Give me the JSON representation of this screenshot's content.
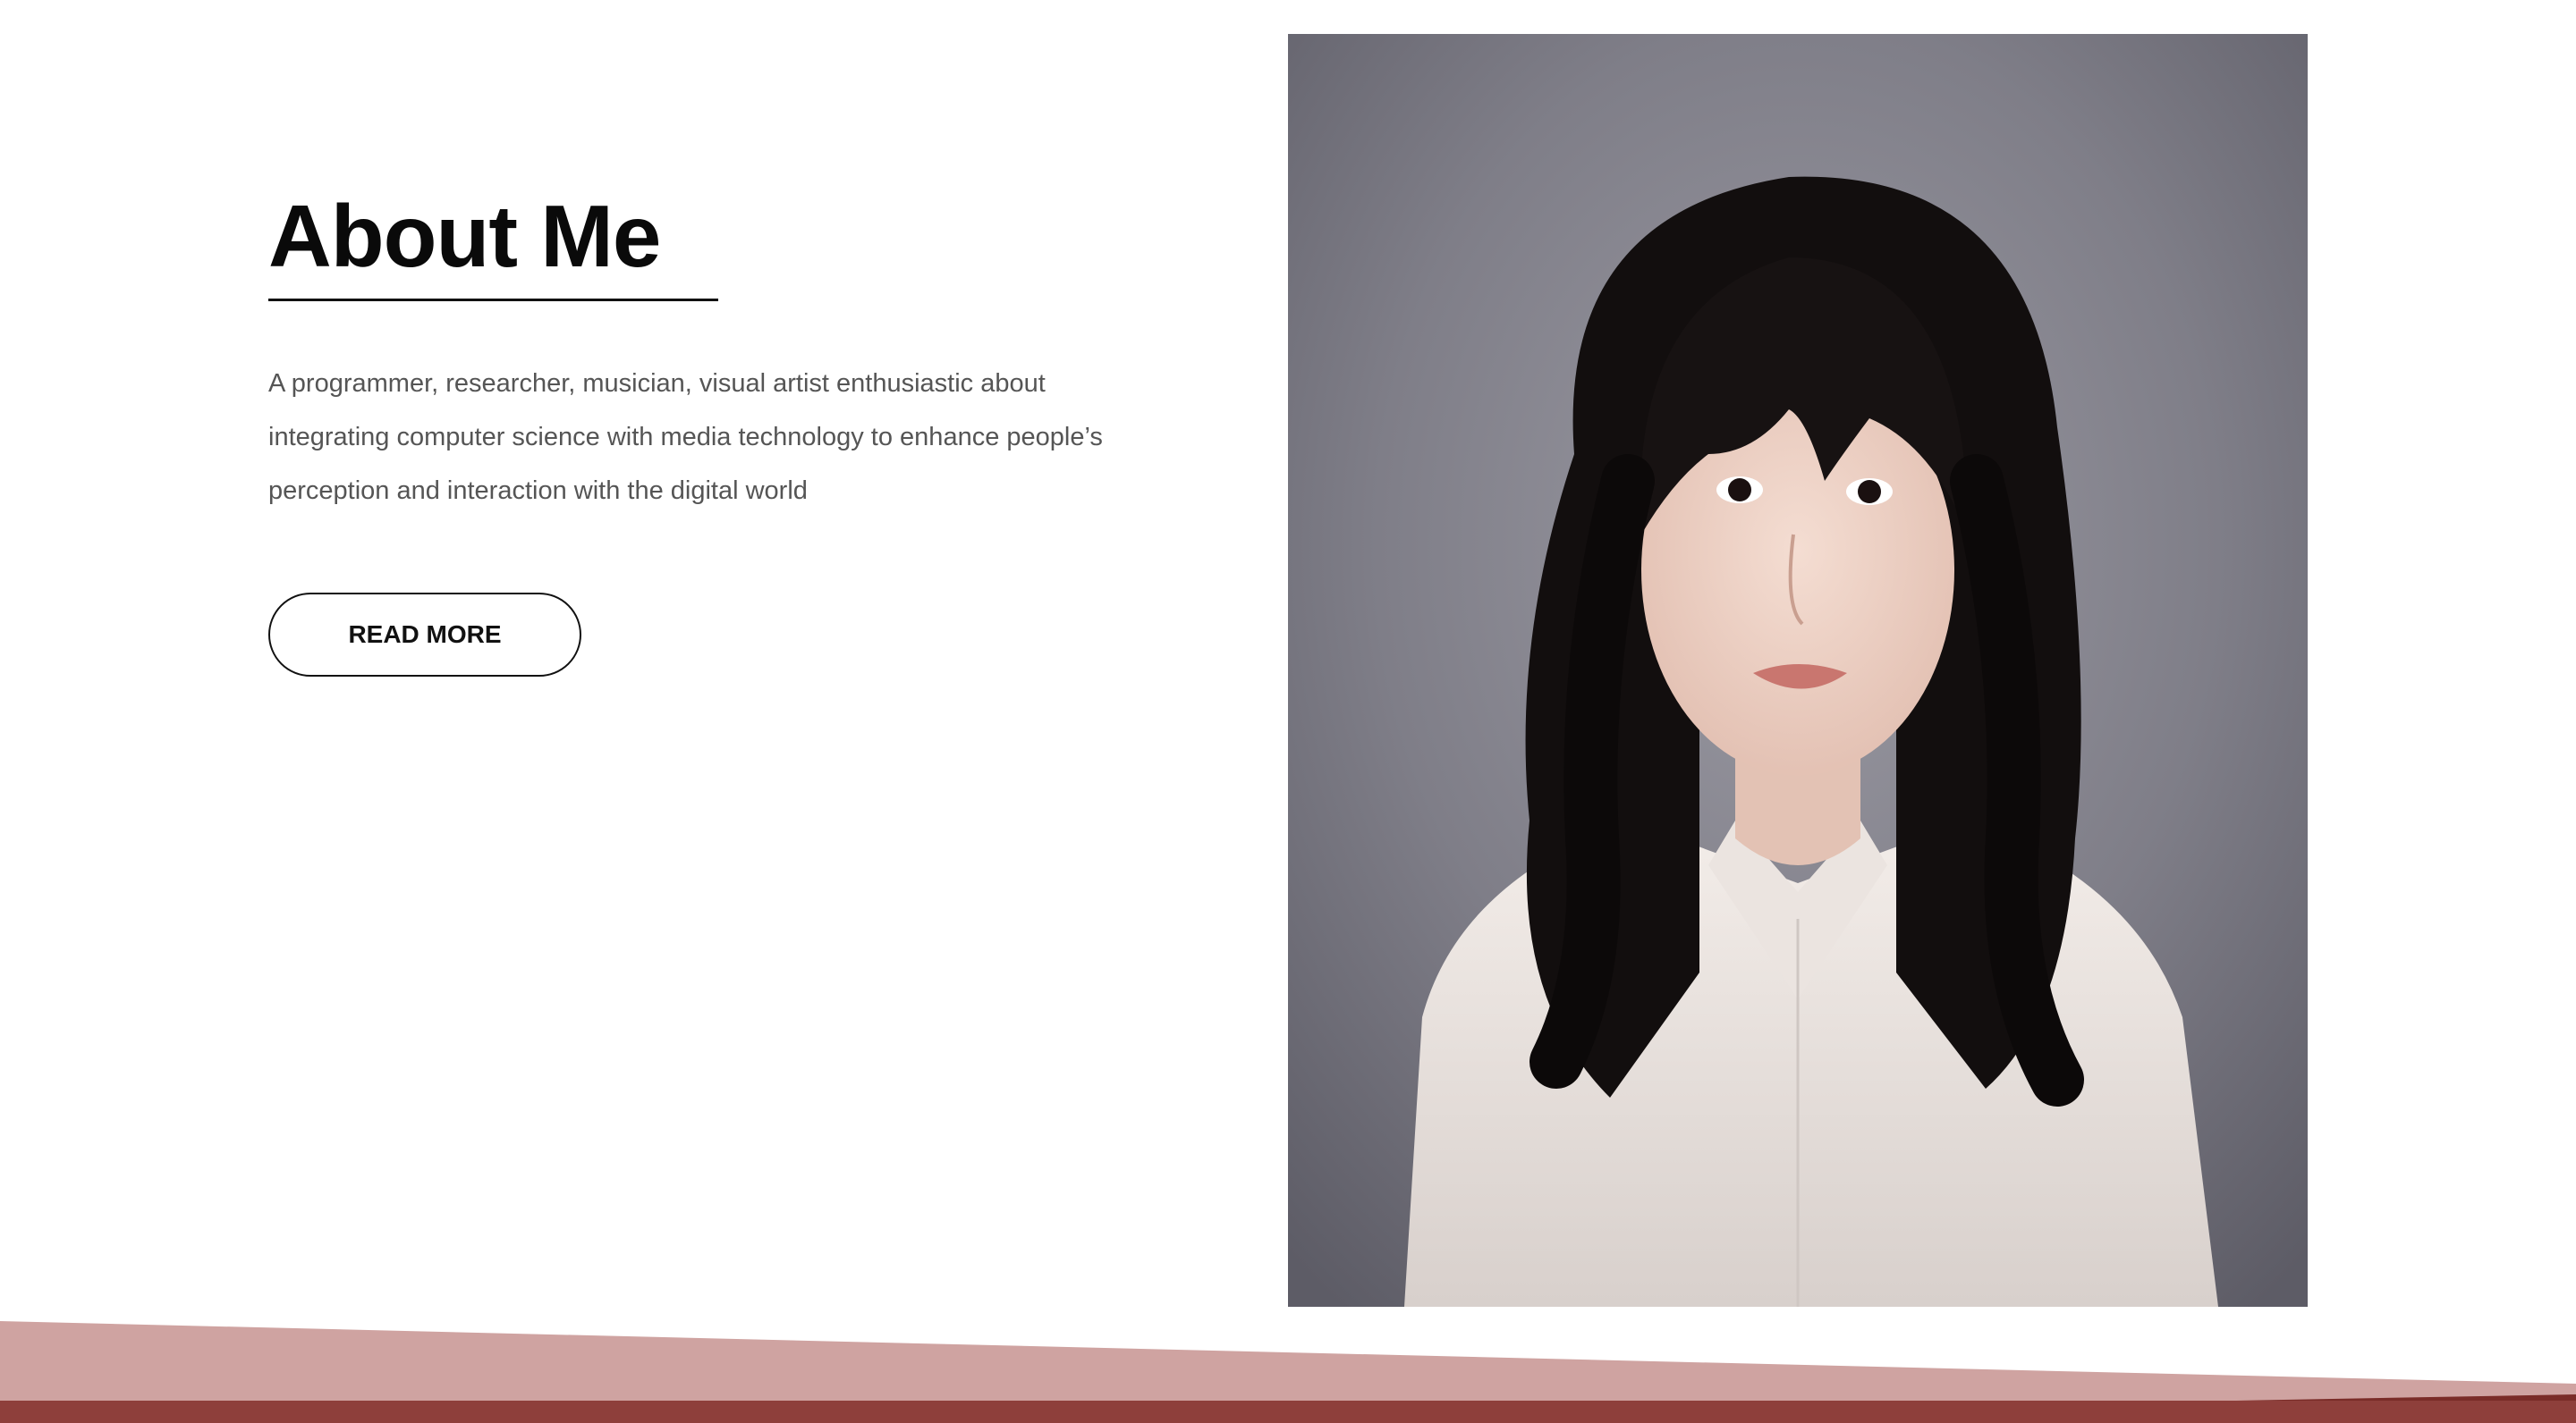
{
  "about": {
    "title": "About Me",
    "description": "A programmer, researcher, musician, visual artist enthusiastic about integrating computer science with media technology to enhance people’s perception and interaction with the digital world",
    "button_label": "READ MORE"
  },
  "portrait": {
    "alt": "Portrait photo"
  },
  "colors": {
    "accent_light": "#cfa3a1",
    "accent_dark": "#8e3f3b",
    "text": "#0a0a0a",
    "body_text": "#555555"
  }
}
